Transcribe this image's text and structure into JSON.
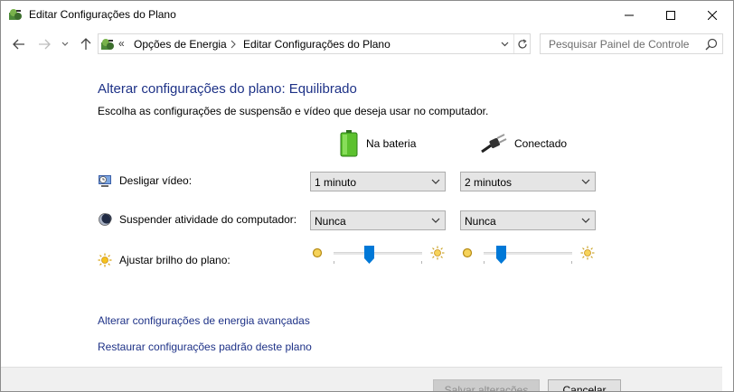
{
  "window": {
    "title": "Editar Configurações do Plano"
  },
  "nav": {
    "overflow": "«",
    "breadcrumbs": [
      "Opções de Energia",
      "Editar Configurações do Plano"
    ],
    "search_placeholder": "Pesquisar Painel de Controle"
  },
  "main": {
    "heading": "Alterar configurações do plano: Equilibrado",
    "description": "Escolha as configurações de suspensão e vídeo que deseja usar no computador.",
    "columns": {
      "battery": "Na bateria",
      "plugged": "Conectado"
    },
    "rows": {
      "display": {
        "label": "Desligar vídeo:",
        "battery_value": "1 minuto",
        "plugged_value": "2 minutos"
      },
      "sleep": {
        "label": "Suspender atividade do computador:",
        "battery_value": "Nunca",
        "plugged_value": "Nunca"
      },
      "brightness": {
        "label": "Ajustar brilho do plano:",
        "battery_level_percent": 40,
        "plugged_level_percent": 20
      }
    },
    "links": {
      "advanced": "Alterar configurações de energia avançadas",
      "restore": "Restaurar configurações padrão deste plano"
    }
  },
  "footer": {
    "save_label": "Salvar alterações",
    "cancel_label": "Cancelar"
  },
  "colors": {
    "link": "#1e3287",
    "slider_thumb": "#0078d7"
  }
}
